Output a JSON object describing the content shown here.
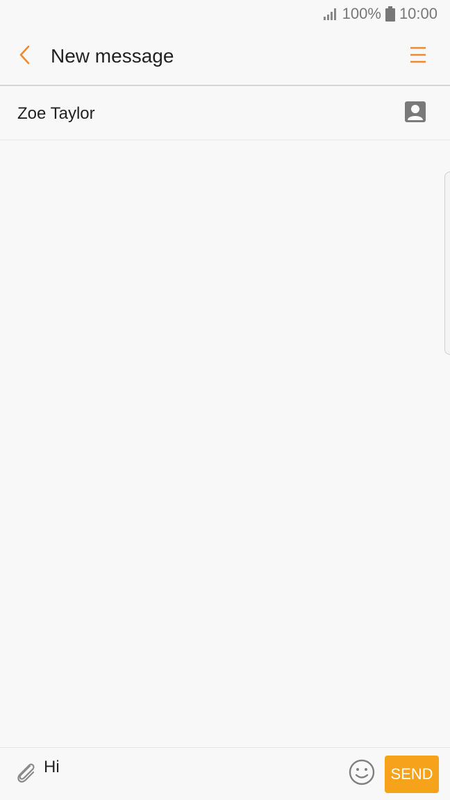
{
  "status_bar": {
    "battery_percent": "100%",
    "time": "10:00",
    "signal_icon": "signal-icon",
    "battery_icon": "battery-icon"
  },
  "app_bar": {
    "title": "New message",
    "back_icon": "chevron-left-icon",
    "menu_icon": "hamburger-menu-icon"
  },
  "recipient": {
    "name": "Zoe Taylor",
    "contact_icon": "contact-card-icon"
  },
  "composer": {
    "message_value": "Hi",
    "attach_icon": "paperclip-icon",
    "emoji_icon": "smiley-icon",
    "send_label": "SEND"
  },
  "colors": {
    "accent": "#f0892b",
    "send_button": "#f7a21b",
    "background": "#f8f8f8",
    "status_text": "#777777"
  }
}
